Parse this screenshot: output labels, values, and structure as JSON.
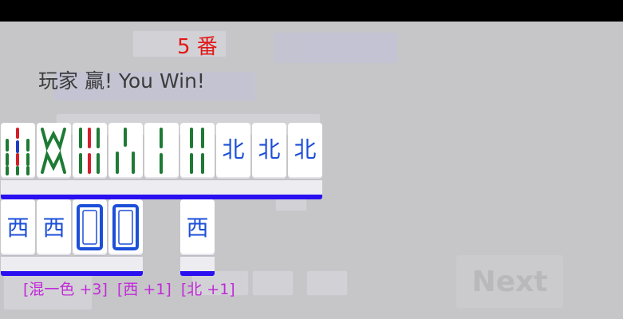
{
  "result": {
    "fan_count": "5 番",
    "title": "玩家 贏! You Win!"
  },
  "buttons": {
    "next_label": "Next"
  },
  "hand": {
    "row1": [
      {
        "suit": "bamboo",
        "rank": 9
      },
      {
        "suit": "bamboo",
        "rank": 8
      },
      {
        "suit": "bamboo",
        "rank": 6
      },
      {
        "suit": "bamboo",
        "rank": 3
      },
      {
        "suit": "bamboo",
        "rank": 2
      },
      {
        "suit": "bamboo",
        "rank": 4
      },
      {
        "suit": "honor",
        "char": "北"
      },
      {
        "suit": "honor",
        "char": "北"
      },
      {
        "suit": "honor",
        "char": "北"
      }
    ],
    "row2": [
      {
        "suit": "honor",
        "char": "西"
      },
      {
        "suit": "honor",
        "char": "西"
      },
      {
        "suit": "dragon",
        "char": "white"
      },
      {
        "suit": "dragon",
        "char": "white"
      },
      {
        "suit": "honor",
        "char": "西"
      }
    ]
  },
  "scoring": {
    "items": [
      "[混一色 +3]",
      "[西 +1]",
      "[北 +1]"
    ]
  },
  "colors": {
    "fan": "#e21818",
    "scoring": "#c22ad8",
    "honor_blue": "#1c4fd8",
    "bamboo_green": "#1e7a34",
    "bamboo_red": "#d21f2a",
    "tile_edge_blue": "#2a0ff0",
    "background": "#c6c6c9"
  }
}
